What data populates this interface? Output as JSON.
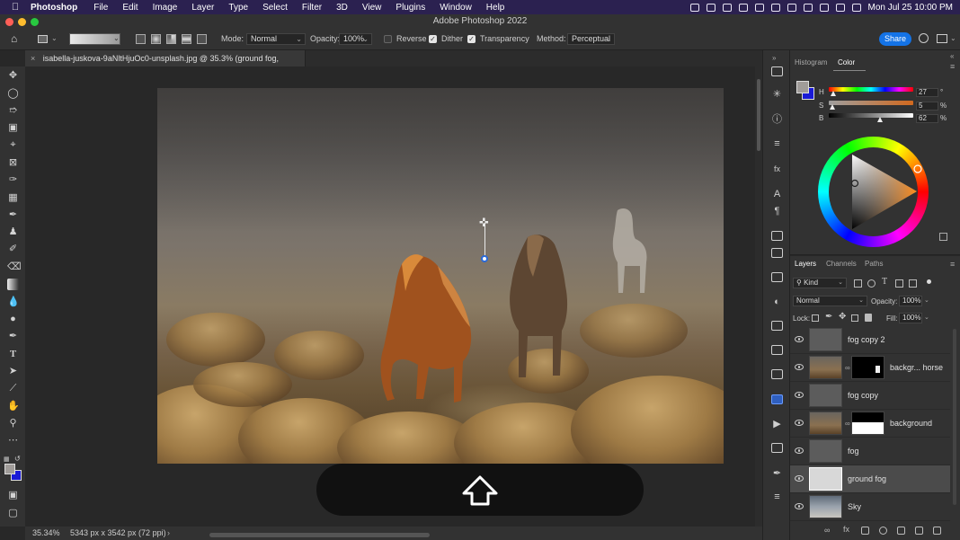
{
  "menubar": {
    "app": "Photoshop",
    "items": [
      "File",
      "Edit",
      "Image",
      "Layer",
      "Type",
      "Select",
      "Filter",
      "3D",
      "View",
      "Plugins",
      "Window",
      "Help"
    ],
    "clock": "Mon Jul 25  10:00 PM"
  },
  "window": {
    "title": "Adobe Photoshop 2022"
  },
  "options": {
    "mode_label": "Mode:",
    "mode_value": "Normal",
    "opacity_label": "Opacity:",
    "opacity_value": "100%",
    "reverse_label": "Reverse",
    "reverse_checked": false,
    "dither_label": "Dither",
    "dither_checked": true,
    "transparency_label": "Transparency",
    "transparency_checked": true,
    "method_label": "Method:",
    "method_value": "Perceptual",
    "share_label": "Share"
  },
  "document": {
    "tab_title": "isabella-juskova-9aNltHjuOc0-unsplash.jpg @ 35.3% (ground fog, RGB/8*) *",
    "zoom": "35.34%",
    "dimensions": "5343 px x 3542 px (72 ppi)"
  },
  "color_panel": {
    "tabs": [
      "Histogram",
      "Color"
    ],
    "active_tab": "Color",
    "h_label": "H",
    "h_value": "27",
    "h_unit": "°",
    "s_label": "S",
    "s_value": "5",
    "s_unit": "%",
    "b_label": "B",
    "b_value": "62",
    "b_unit": "%",
    "foreground_color": "#a09c99",
    "background_color": "#1a1ad6"
  },
  "layers_panel": {
    "tabs": [
      "Layers",
      "Channels",
      "Paths"
    ],
    "active_tab": "Layers",
    "filter_label": "Kind",
    "blend_mode": "Normal",
    "opacity_label": "Opacity:",
    "opacity_value": "100%",
    "lock_label": "Lock:",
    "fill_label": "Fill:",
    "fill_value": "100%",
    "layers": [
      {
        "name": "fog copy 2",
        "has_mask": false,
        "selected": false
      },
      {
        "name": "backgr... horse",
        "has_mask": true,
        "selected": false
      },
      {
        "name": "fog copy",
        "has_mask": false,
        "selected": false
      },
      {
        "name": "background",
        "has_mask": true,
        "selected": false
      },
      {
        "name": "fog",
        "has_mask": false,
        "selected": false
      },
      {
        "name": "ground fog",
        "has_mask": false,
        "selected": true
      },
      {
        "name": "Sky",
        "has_mask": false,
        "selected": false
      }
    ]
  }
}
